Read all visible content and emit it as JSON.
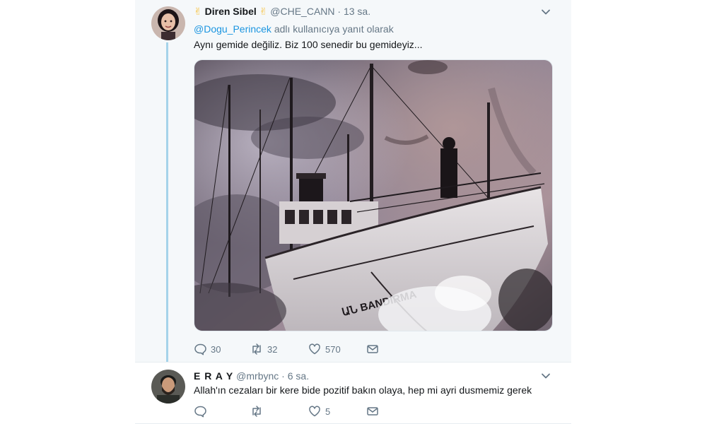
{
  "main_tweet": {
    "display_name": "Diren Sibel",
    "name_emoji": "✌",
    "handle": "@CHE_CANN",
    "separator": "·",
    "time": "13 sa.",
    "reply_mention": "@Dogu_Perincek",
    "reply_suffix": " adlı kullanıcıya yanıt olarak",
    "text": "Aynı gemide değiliz. Biz 100 senedir bu gemideyiz...",
    "media": {
      "ship_name": "BANDIRMA",
      "ship_name_prefix": "ԱՆ"
    },
    "actions": {
      "reply_count": "30",
      "retweet_count": "32",
      "like_count": "570"
    }
  },
  "reply_tweet": {
    "display_name": "E R A Y",
    "handle": "@mrbync",
    "separator": "·",
    "time": "6 sa.",
    "text": "Allah'ın cezaları bir kere bide pozitif bakın olaya, hep mi ayri dusmemiz gerek",
    "actions": {
      "like_count": "5"
    }
  },
  "colors": {
    "accent": "#1b95e0",
    "muted": "#657786",
    "thread_line": "#a5d3ea",
    "tweet_bg": "#f5f8fa"
  },
  "icons": [
    "reply-icon",
    "retweet-icon",
    "like-icon",
    "message-icon",
    "chevron-down-icon"
  ]
}
